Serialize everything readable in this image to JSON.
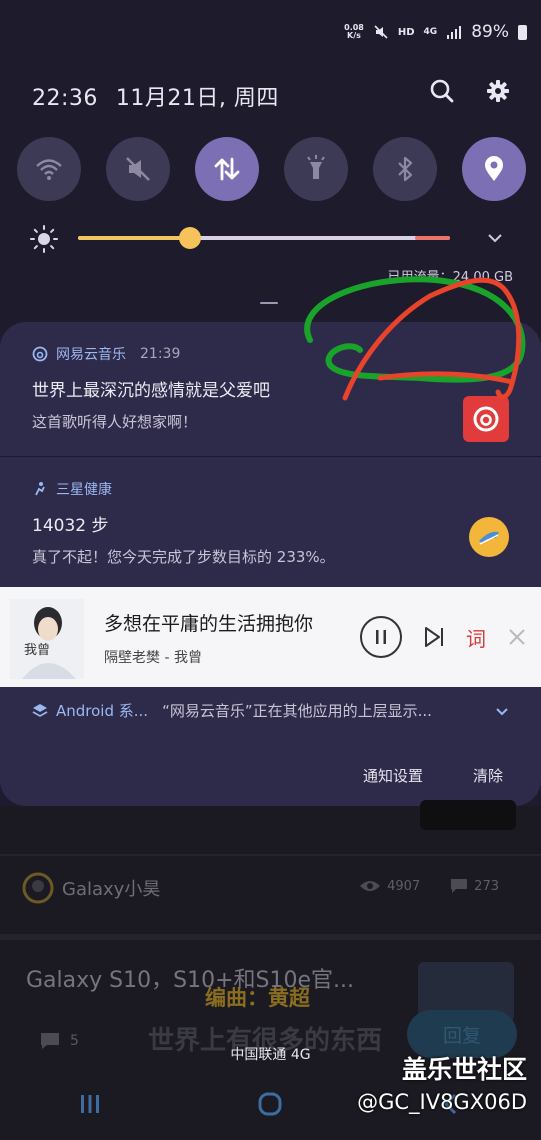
{
  "status_bar": {
    "net_speed_value": "0.08",
    "net_speed_unit": "K/s",
    "hd": "HD",
    "network": "4G",
    "battery": "89%"
  },
  "header": {
    "time": "22:36",
    "date": "11月21日, 周四"
  },
  "quick_settings": [
    {
      "name": "wifi",
      "active": false
    },
    {
      "name": "mute",
      "active": false
    },
    {
      "name": "mobile-data",
      "active": true
    },
    {
      "name": "flashlight",
      "active": false
    },
    {
      "name": "bluetooth",
      "active": false
    },
    {
      "name": "location",
      "active": true
    }
  ],
  "brightness": {
    "level": 0.3
  },
  "data_usage": "已用流量：24.00 GB",
  "notifications": [
    {
      "app": "网易云音乐",
      "time": "21:39",
      "title": "世界上最深沉的感情就是父爱吧",
      "body": "这首歌听得人好想家啊！"
    },
    {
      "app": "三星健康",
      "title": "14032 步",
      "body": "真了不起！您今天完成了步数目标的 233%。"
    }
  ],
  "media_player": {
    "song": "多想在平庸的生活拥抱你",
    "artist": "隔壁老樊 - 我曾",
    "lyric_label": "词",
    "cover_text": "我曾"
  },
  "system_notification": {
    "app": "Android 系...",
    "text": "“网易云音乐”正在其他应用的上层显示..."
  },
  "panel_footer": {
    "settings": "通知设置",
    "clear": "清除"
  },
  "background_app": {
    "author": "Galaxy小昊",
    "views": "4907",
    "comments": "273",
    "post_title": "Galaxy S10，S10+和S10e官...",
    "overlay_line1": "编曲：黄超",
    "overlay_line2": "世界上有很多的东西",
    "reply": "回复",
    "comment_count": "5"
  },
  "carrier": "中国联通 4G",
  "watermark": {
    "line1": "盖乐世社区",
    "line2": "@GC_IV8GX06D"
  },
  "colors": {
    "panel": "#2e2a4a",
    "shade": "#1d1b2c",
    "qs_inactive": "#3d3a55",
    "qs_active": "#7c6fb3",
    "accent_blue": "#9bb8f0",
    "scribble_green": "#1aa32a",
    "scribble_red": "#e8432b"
  }
}
